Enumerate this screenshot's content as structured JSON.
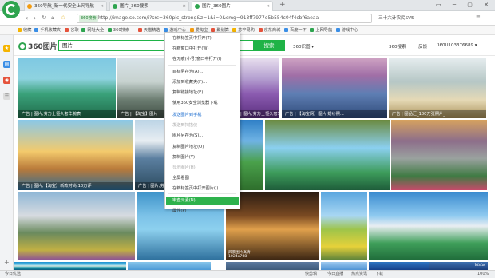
{
  "tabs": [
    {
      "label": "360导航_新一代安全上网导航",
      "fav": "#f39c12"
    },
    {
      "label": "图片_360搜索",
      "fav": "#2ea44f"
    },
    {
      "label": "图片_360图片",
      "fav": "#2ea44f"
    }
  ],
  "new_tab_icon": "plus-icon",
  "window_buttons": "▭ ─ ▢ ✕",
  "address": {
    "badge": "360搜索",
    "url": "http://image.so.com/i?src=360pic_strong&z=1&i=0&cmg=913ff7977e5b554c04f4cbf6aeaa",
    "right_search": "三十六计农民SV5"
  },
  "bookmarks": [
    "收藏",
    "手机收藏夹",
    "谷歌",
    "网址大全",
    "360搜索",
    "天猫精选",
    "游戏中心",
    "爱淘宝",
    "聚划算",
    "苏宁易购",
    "京东商城",
    "百度一下",
    "上网导航",
    "游戏中心"
  ],
  "search": {
    "brand": "360图片",
    "query": "图片",
    "button": "搜索",
    "options": [
      "360识图 ▾",
      "360搜索",
      "反馈",
      "360U103376689 ▾"
    ]
  },
  "images": [
    {
      "caption": "广告 | 图片,劳力士恒久奢华腕表",
      "grad": "linear-gradient(180deg,#7ec8e3 0%,#8fd3e0 35%,#3aa17a 60%,#1f6b4a 100%)"
    },
    {
      "caption": "广告 | 【淘宝】图片",
      "grad": "linear-gradient(180deg,#d9e4ea 0%,#c7d2cf 40%,#6b7c70 70%,#3f4d44 100%)"
    },
    {
      "caption": "广告 | 图片,劳力士恒久奢华...",
      "grad": "linear-gradient(180deg,#e9e0ef 0%,#b49fd0 35%,#8b5bb0 60%,#5a2f7e 100%)"
    },
    {
      "caption": "广告 | 【淘宝网】图片,婚纱照...",
      "grad": "linear-gradient(180deg,#cfa4c4 0%,#a06ea6 30%,#5e7eb3 60%,#2f4a79 100%)"
    },
    {
      "caption": "广告 | 图品汇_100万张照片_",
      "grad": "linear-gradient(180deg,#e6edef 0%,#b6c7c6 40%,#e5d9b6 70%,#a89058 100%)"
    },
    {
      "caption": "广告 | 图片,【淘宝】新款时尚,10万评",
      "grad": "linear-gradient(180deg,#8ac8e8 0%,#f3ca6c 45%,#b97a3a 70%,#2a6e9a 100%)"
    },
    {
      "caption": "广告 | 图片,劳力士恒久奢华腕表",
      "grad": "linear-gradient(180deg,#bcd4e6 0%,#e8eef2 30%,#5b7fa0 55%,#2b4a5e 100%)"
    },
    {
      "caption": "",
      "grad": "linear-gradient(180deg,#2f7fc6 0%,#6fb3e4 30%,#4aa14b 60%,#2e6e2c 100%)"
    },
    {
      "caption": "",
      "grad": "linear-gradient(180deg,#6b8a3f 0%,#8bd0f0 40%,#3d9c5b 75%,#1e5c3a 100%)"
    },
    {
      "caption": "",
      "grad": "linear-gradient(180deg,#d6a25f 0%,#8d6e8a 30%,#9aa29f 55%,#3f7a43 80%,#c74a6b 100%)"
    },
    {
      "caption": "",
      "grad": "linear-gradient(180deg,#8fb7d6 0%,#d7dbe0 35%,#6a8a5e 60%,#c0b044 85%,#8a4d9b 100%)"
    },
    {
      "caption": "",
      "grad": "linear-gradient(180deg,#3e93c9 0%,#7cc2e8 35%,#8dd0ee 55%,#2d6f9c 100%)"
    },
    {
      "caption": "",
      "grad": "linear-gradient(180deg,#2a1c12 0%,#7b4a22 35%,#e0a04c 55%,#3a2412 100%)",
      "size_label": "风景图片高清",
      "size": "1024x768"
    },
    {
      "caption": "",
      "grad": "linear-gradient(180deg,#5aa6df 0%,#a9d7f3 35%,#9ec44a 55%,#e6d13a 80%,#58803a 100%)"
    },
    {
      "caption": "",
      "grad": "linear-gradient(180deg,#3a8bcf 0%,#8fcaf0 35%,#e9eef2 50%,#3f9f5a 75%,#1f6b3a 100%)"
    },
    {
      "caption": "",
      "grad": "linear-gradient(180deg,#1b8fd0 0%,#5ec1e5 30%,#d8e7e0 50%,#1e9aae 70%,#0c5b7c 100%)"
    },
    {
      "caption": "",
      "grad": "linear-gradient(180deg,#86c4ea 0%,#4c9ad6 100%)"
    },
    {
      "caption": "",
      "grad": "linear-gradient(180deg,#5c7aa0 0%,#3d5a7a 100%)"
    },
    {
      "caption": "",
      "grad": "linear-gradient(180deg,#9ec9ef 0%,#4f93d4 100%)"
    },
    {
      "caption": "",
      "grad": "linear-gradient(180deg,#2e74c2 0%,#163f8a 100%)"
    },
    {
      "caption": "",
      "grad": "linear-gradient(180deg,#3d6fb0 0%,#1c3f7c 100%)",
      "watermark": "Vista"
    }
  ],
  "context_menu": [
    {
      "label": "在新标签页中打开(T)",
      "disabled": false
    },
    {
      "label": "在新窗口中打开(W)",
      "disabled": false
    },
    {
      "label": "在无痕(小号)窗口中打开(I)",
      "disabled": false
    },
    {
      "label": "目标另存为(A)...",
      "disabled": false
    },
    {
      "label": "添加到收藏夹(F)...",
      "disabled": false
    },
    {
      "label": "复制链接地址(E)",
      "disabled": false
    },
    {
      "label": "使用360安全浏览器下载",
      "disabled": false
    },
    {
      "label": "发送图片到手机",
      "disabled": false,
      "special": true
    },
    {
      "label": "发送到扫描仪",
      "disabled": true
    },
    {
      "label": "图片另存为(S)...",
      "disabled": false
    },
    {
      "label": "复制图片地址(O)",
      "disabled": false
    },
    {
      "label": "复制图片(Y)",
      "disabled": false
    },
    {
      "label": "显示图片(H)",
      "disabled": true
    },
    {
      "label": "全屏看图",
      "disabled": false
    },
    {
      "label": "在新标签页中打开图片(I)",
      "disabled": false
    },
    {
      "label": "审查元素(N)",
      "disabled": false,
      "highlight": true
    },
    {
      "label": "属性(P)",
      "disabled": false
    }
  ],
  "status": {
    "left": "今日优选",
    "items": [
      "快剪辑",
      "今日直播",
      "热点资讯",
      "下载",
      "",
      "100%"
    ]
  },
  "colors": {
    "accent": "#1fb347",
    "brand": "#2ea44f",
    "highlight": "#2eb24c"
  }
}
